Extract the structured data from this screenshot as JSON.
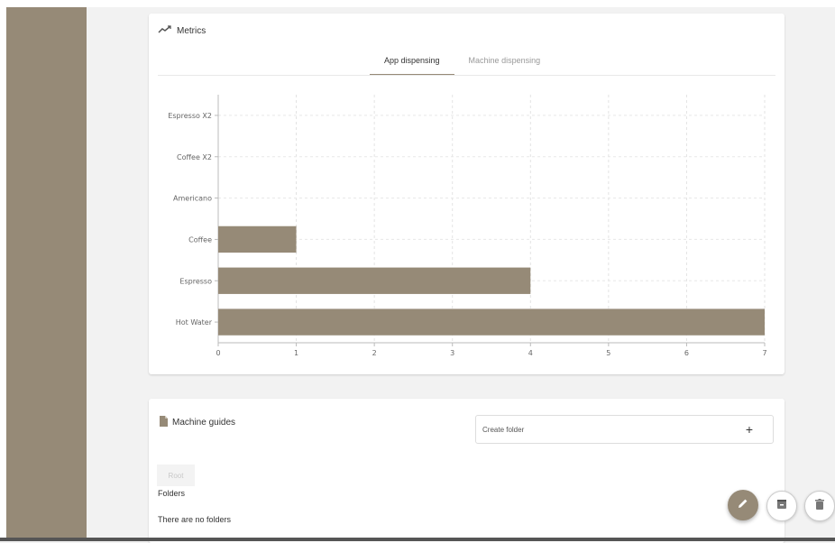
{
  "metrics": {
    "title": "Metrics",
    "icon": "trending-up-icon",
    "tabs": [
      {
        "label": "App dispensing",
        "active": true
      },
      {
        "label": "Machine dispensing",
        "active": false
      }
    ]
  },
  "chart_data": {
    "type": "bar",
    "orientation": "horizontal",
    "categories": [
      "Espresso X2",
      "Coffee X2",
      "Americano",
      "Coffee",
      "Espresso",
      "Hot Water"
    ],
    "values": [
      0,
      0,
      0,
      1,
      4,
      7
    ],
    "x_ticks": [
      "0",
      "1",
      "2",
      "3",
      "4",
      "5",
      "6",
      "7"
    ],
    "xlim": [
      0,
      7
    ],
    "grid": true,
    "bar_color": "#968a77",
    "title": "",
    "xlabel": "",
    "ylabel": ""
  },
  "guides": {
    "title": "Machine guides",
    "icon": "document-icon",
    "create_folder_label": "Create folder",
    "create_folder_icon": "+",
    "root_label": "Root",
    "folders_label": "Folders",
    "empty_text": "There are no folders"
  },
  "actions": {
    "edit_icon": "pencil-icon",
    "archive_icon": "archive-icon",
    "delete_icon": "trash-icon"
  },
  "colors": {
    "sidebar": "#968a77",
    "accent": "#968a77"
  }
}
